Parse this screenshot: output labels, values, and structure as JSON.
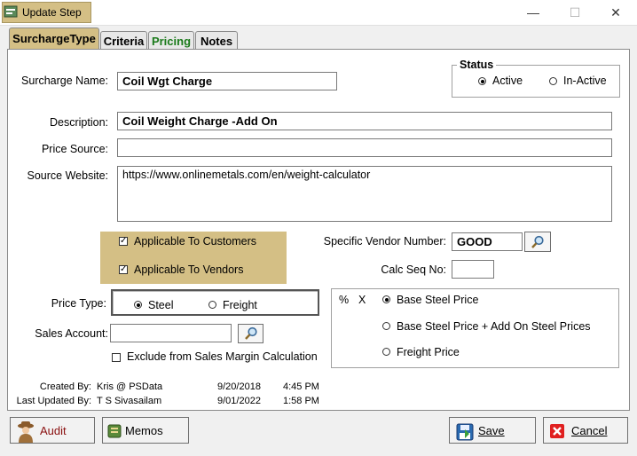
{
  "window": {
    "title": "Update Step",
    "minimize": "—",
    "maximize": "☐",
    "close": "✕"
  },
  "tabs": [
    {
      "label": "SurchargeType",
      "color": "#000000"
    },
    {
      "label": "Criteria",
      "color": "#000000"
    },
    {
      "label": "Pricing",
      "color": "#1a7a1a"
    },
    {
      "label": "Notes",
      "color": "#000000"
    }
  ],
  "form": {
    "surcharge_name_label": "Surcharge Name:",
    "surcharge_name_value": "Coil Wgt Charge",
    "status_title": "Status",
    "status_active": "Active",
    "status_inactive": "In-Active",
    "description_label": "Description:",
    "description_value": "Coil Weight Charge -Add On",
    "price_source_label": "Price Source:",
    "price_source_value": "",
    "source_website_label": "Source Website:",
    "source_website_value": "https://www.onlinemetals.com/en/weight-calculator",
    "applicable_customers": "Applicable To Customers",
    "applicable_vendors": "Applicable To Vendors",
    "vendor_number_label": "Specific Vendor Number:",
    "vendor_number_value": "GOOD",
    "calc_seq_label": "Calc Seq No:",
    "calc_seq_value": "",
    "price_type_label": "Price Type:",
    "price_type_steel": "Steel",
    "price_type_freight": "Freight",
    "sales_account_label": "Sales Account:",
    "sales_account_value": "",
    "exclude_label": "Exclude from Sales Margin Calculation",
    "percent_symbol": "%",
    "x_symbol": "X",
    "base_steel_price": "Base Steel Price",
    "base_steel_addon": "Base Steel Price + Add On Steel Prices",
    "freight_price": "Freight Price"
  },
  "audit": {
    "created_by_label": "Created By:",
    "created_by_user": "Kris @ PSData",
    "created_date": "9/20/2018",
    "created_time": "4:45 PM",
    "updated_by_label": "Last Updated By:",
    "updated_by_user": "T S Sivasailam",
    "updated_date": "9/01/2022",
    "updated_time": "1:58 PM"
  },
  "buttons": {
    "audit": "Audit",
    "memos": "Memos",
    "save": "Save",
    "cancel": "Cancel"
  },
  "colors": {
    "accent": "#d4bf85",
    "cancel_red": "#e02020"
  }
}
